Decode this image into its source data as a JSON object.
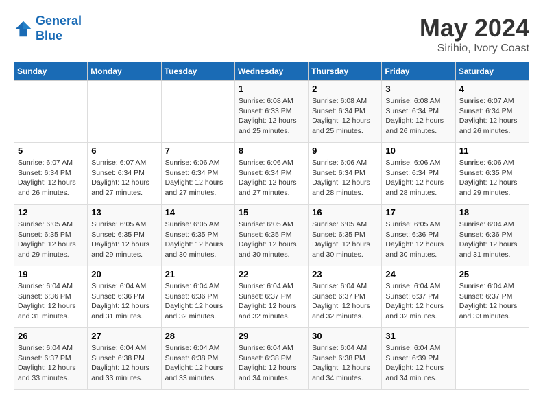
{
  "header": {
    "logo_line1": "General",
    "logo_line2": "Blue",
    "month": "May 2024",
    "location": "Sirihio, Ivory Coast"
  },
  "days_of_week": [
    "Sunday",
    "Monday",
    "Tuesday",
    "Wednesday",
    "Thursday",
    "Friday",
    "Saturday"
  ],
  "weeks": [
    [
      {
        "day": "",
        "info": ""
      },
      {
        "day": "",
        "info": ""
      },
      {
        "day": "",
        "info": ""
      },
      {
        "day": "1",
        "info": "Sunrise: 6:08 AM\nSunset: 6:33 PM\nDaylight: 12 hours\nand 25 minutes."
      },
      {
        "day": "2",
        "info": "Sunrise: 6:08 AM\nSunset: 6:34 PM\nDaylight: 12 hours\nand 25 minutes."
      },
      {
        "day": "3",
        "info": "Sunrise: 6:08 AM\nSunset: 6:34 PM\nDaylight: 12 hours\nand 26 minutes."
      },
      {
        "day": "4",
        "info": "Sunrise: 6:07 AM\nSunset: 6:34 PM\nDaylight: 12 hours\nand 26 minutes."
      }
    ],
    [
      {
        "day": "5",
        "info": "Sunrise: 6:07 AM\nSunset: 6:34 PM\nDaylight: 12 hours\nand 26 minutes."
      },
      {
        "day": "6",
        "info": "Sunrise: 6:07 AM\nSunset: 6:34 PM\nDaylight: 12 hours\nand 27 minutes."
      },
      {
        "day": "7",
        "info": "Sunrise: 6:06 AM\nSunset: 6:34 PM\nDaylight: 12 hours\nand 27 minutes."
      },
      {
        "day": "8",
        "info": "Sunrise: 6:06 AM\nSunset: 6:34 PM\nDaylight: 12 hours\nand 27 minutes."
      },
      {
        "day": "9",
        "info": "Sunrise: 6:06 AM\nSunset: 6:34 PM\nDaylight: 12 hours\nand 28 minutes."
      },
      {
        "day": "10",
        "info": "Sunrise: 6:06 AM\nSunset: 6:34 PM\nDaylight: 12 hours\nand 28 minutes."
      },
      {
        "day": "11",
        "info": "Sunrise: 6:06 AM\nSunset: 6:35 PM\nDaylight: 12 hours\nand 29 minutes."
      }
    ],
    [
      {
        "day": "12",
        "info": "Sunrise: 6:05 AM\nSunset: 6:35 PM\nDaylight: 12 hours\nand 29 minutes."
      },
      {
        "day": "13",
        "info": "Sunrise: 6:05 AM\nSunset: 6:35 PM\nDaylight: 12 hours\nand 29 minutes."
      },
      {
        "day": "14",
        "info": "Sunrise: 6:05 AM\nSunset: 6:35 PM\nDaylight: 12 hours\nand 30 minutes."
      },
      {
        "day": "15",
        "info": "Sunrise: 6:05 AM\nSunset: 6:35 PM\nDaylight: 12 hours\nand 30 minutes."
      },
      {
        "day": "16",
        "info": "Sunrise: 6:05 AM\nSunset: 6:35 PM\nDaylight: 12 hours\nand 30 minutes."
      },
      {
        "day": "17",
        "info": "Sunrise: 6:05 AM\nSunset: 6:36 PM\nDaylight: 12 hours\nand 30 minutes."
      },
      {
        "day": "18",
        "info": "Sunrise: 6:04 AM\nSunset: 6:36 PM\nDaylight: 12 hours\nand 31 minutes."
      }
    ],
    [
      {
        "day": "19",
        "info": "Sunrise: 6:04 AM\nSunset: 6:36 PM\nDaylight: 12 hours\nand 31 minutes."
      },
      {
        "day": "20",
        "info": "Sunrise: 6:04 AM\nSunset: 6:36 PM\nDaylight: 12 hours\nand 31 minutes."
      },
      {
        "day": "21",
        "info": "Sunrise: 6:04 AM\nSunset: 6:36 PM\nDaylight: 12 hours\nand 32 minutes."
      },
      {
        "day": "22",
        "info": "Sunrise: 6:04 AM\nSunset: 6:37 PM\nDaylight: 12 hours\nand 32 minutes."
      },
      {
        "day": "23",
        "info": "Sunrise: 6:04 AM\nSunset: 6:37 PM\nDaylight: 12 hours\nand 32 minutes."
      },
      {
        "day": "24",
        "info": "Sunrise: 6:04 AM\nSunset: 6:37 PM\nDaylight: 12 hours\nand 32 minutes."
      },
      {
        "day": "25",
        "info": "Sunrise: 6:04 AM\nSunset: 6:37 PM\nDaylight: 12 hours\nand 33 minutes."
      }
    ],
    [
      {
        "day": "26",
        "info": "Sunrise: 6:04 AM\nSunset: 6:37 PM\nDaylight: 12 hours\nand 33 minutes."
      },
      {
        "day": "27",
        "info": "Sunrise: 6:04 AM\nSunset: 6:38 PM\nDaylight: 12 hours\nand 33 minutes."
      },
      {
        "day": "28",
        "info": "Sunrise: 6:04 AM\nSunset: 6:38 PM\nDaylight: 12 hours\nand 33 minutes."
      },
      {
        "day": "29",
        "info": "Sunrise: 6:04 AM\nSunset: 6:38 PM\nDaylight: 12 hours\nand 34 minutes."
      },
      {
        "day": "30",
        "info": "Sunrise: 6:04 AM\nSunset: 6:38 PM\nDaylight: 12 hours\nand 34 minutes."
      },
      {
        "day": "31",
        "info": "Sunrise: 6:04 AM\nSunset: 6:39 PM\nDaylight: 12 hours\nand 34 minutes."
      },
      {
        "day": "",
        "info": ""
      }
    ]
  ]
}
